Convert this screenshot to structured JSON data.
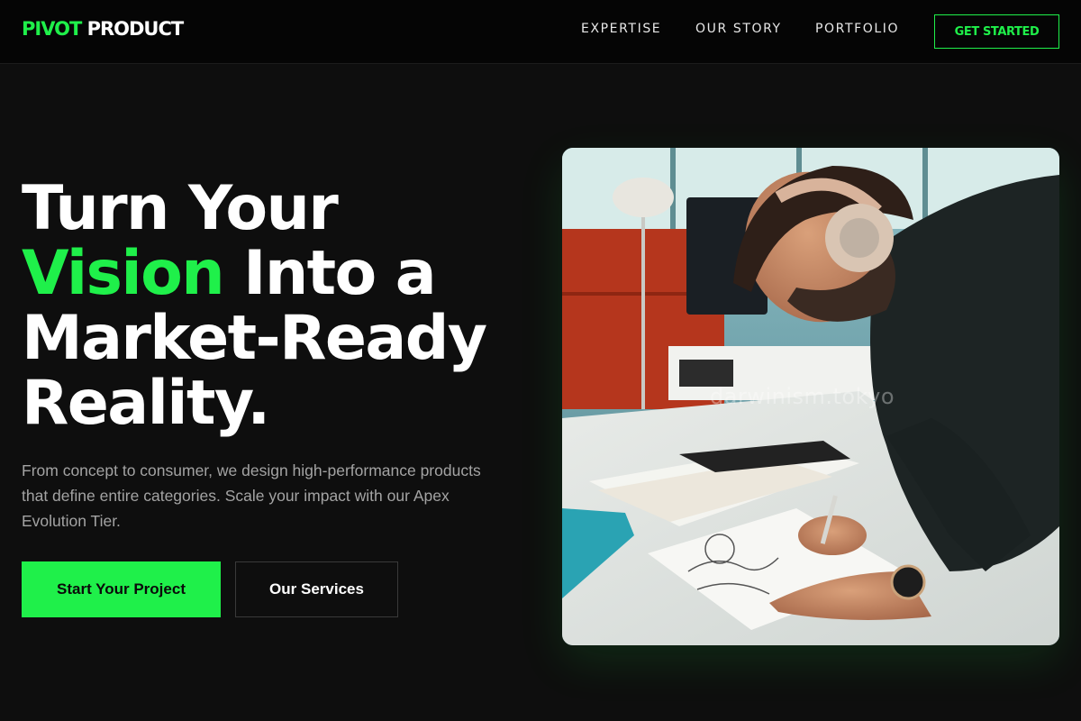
{
  "nav": {
    "logo_accent": "PIVOT",
    "logo_rest": "PRODUCT",
    "links": [
      {
        "label": "EXPERTISE"
      },
      {
        "label": "OUR STORY"
      },
      {
        "label": "PORTFOLIO"
      }
    ],
    "cta_label": "GET STARTED"
  },
  "hero": {
    "headline": {
      "line1": "Turn Your",
      "highlight": "Vision",
      "line2_rest": " Into a",
      "line3": "Market-Ready",
      "line4": "Reality."
    },
    "subtext": "From concept to consumer, we design high-performance products that define entire categories. Scale your impact with our Apex Evolution Tier.",
    "primary_button": "Start Your Project",
    "secondary_button": "Our Services",
    "image_watermark": "darwinism.tokyo"
  },
  "colors": {
    "accent": "#1ff04a",
    "background": "#0e0e0e",
    "nav_background": "#050505",
    "muted_text": "#a3a3a3"
  }
}
